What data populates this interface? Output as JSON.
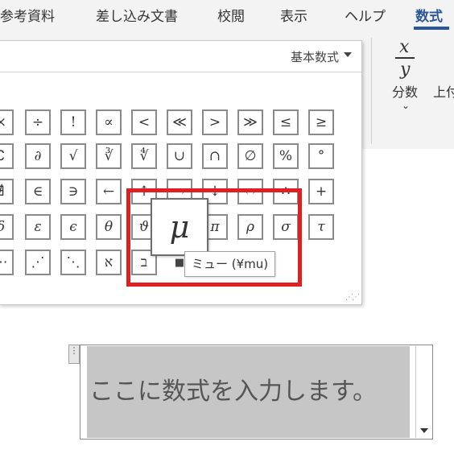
{
  "ribbon": {
    "tabs": [
      {
        "label": "参考資料"
      },
      {
        "label": "差し込み文書"
      },
      {
        "label": "校閲"
      },
      {
        "label": "表示"
      },
      {
        "label": "ヘルプ"
      },
      {
        "label": "数式",
        "active": true
      }
    ],
    "fraction": {
      "numerator": "x",
      "denominator": "y",
      "label": "分数"
    },
    "next_group_label": "上付"
  },
  "gallery": {
    "title": "基本数式",
    "rows": [
      [
        "×",
        "÷",
        "!",
        "∝",
        "<",
        "≪",
        ">",
        "≫",
        "≤",
        "≥"
      ],
      [
        "∁",
        "∂",
        "√",
        "∛",
        "∜",
        "∪",
        "∩",
        "∅",
        "%",
        "°"
      ],
      [
        "∄",
        "∈",
        "∋",
        "←",
        "↑",
        "→",
        "↓",
        "↔",
        "∴",
        "+"
      ],
      [
        "δ",
        "ε",
        "ϵ",
        "θ",
        "ϑ",
        "μ",
        "π",
        "ρ",
        "σ",
        "τ"
      ],
      [
        "⋯",
        "⋰",
        "⋱",
        "א",
        "ב",
        "■"
      ]
    ],
    "hover": {
      "symbol": "μ",
      "tooltip": "ミュー (¥mu)"
    }
  },
  "equation": {
    "placeholder": "ここに数式を入力します。",
    "handle_glyph": "⋮"
  },
  "colors": {
    "accent": "#2b579a",
    "highlight": "#e02020",
    "placeholder_bg": "#c6c6c6"
  }
}
